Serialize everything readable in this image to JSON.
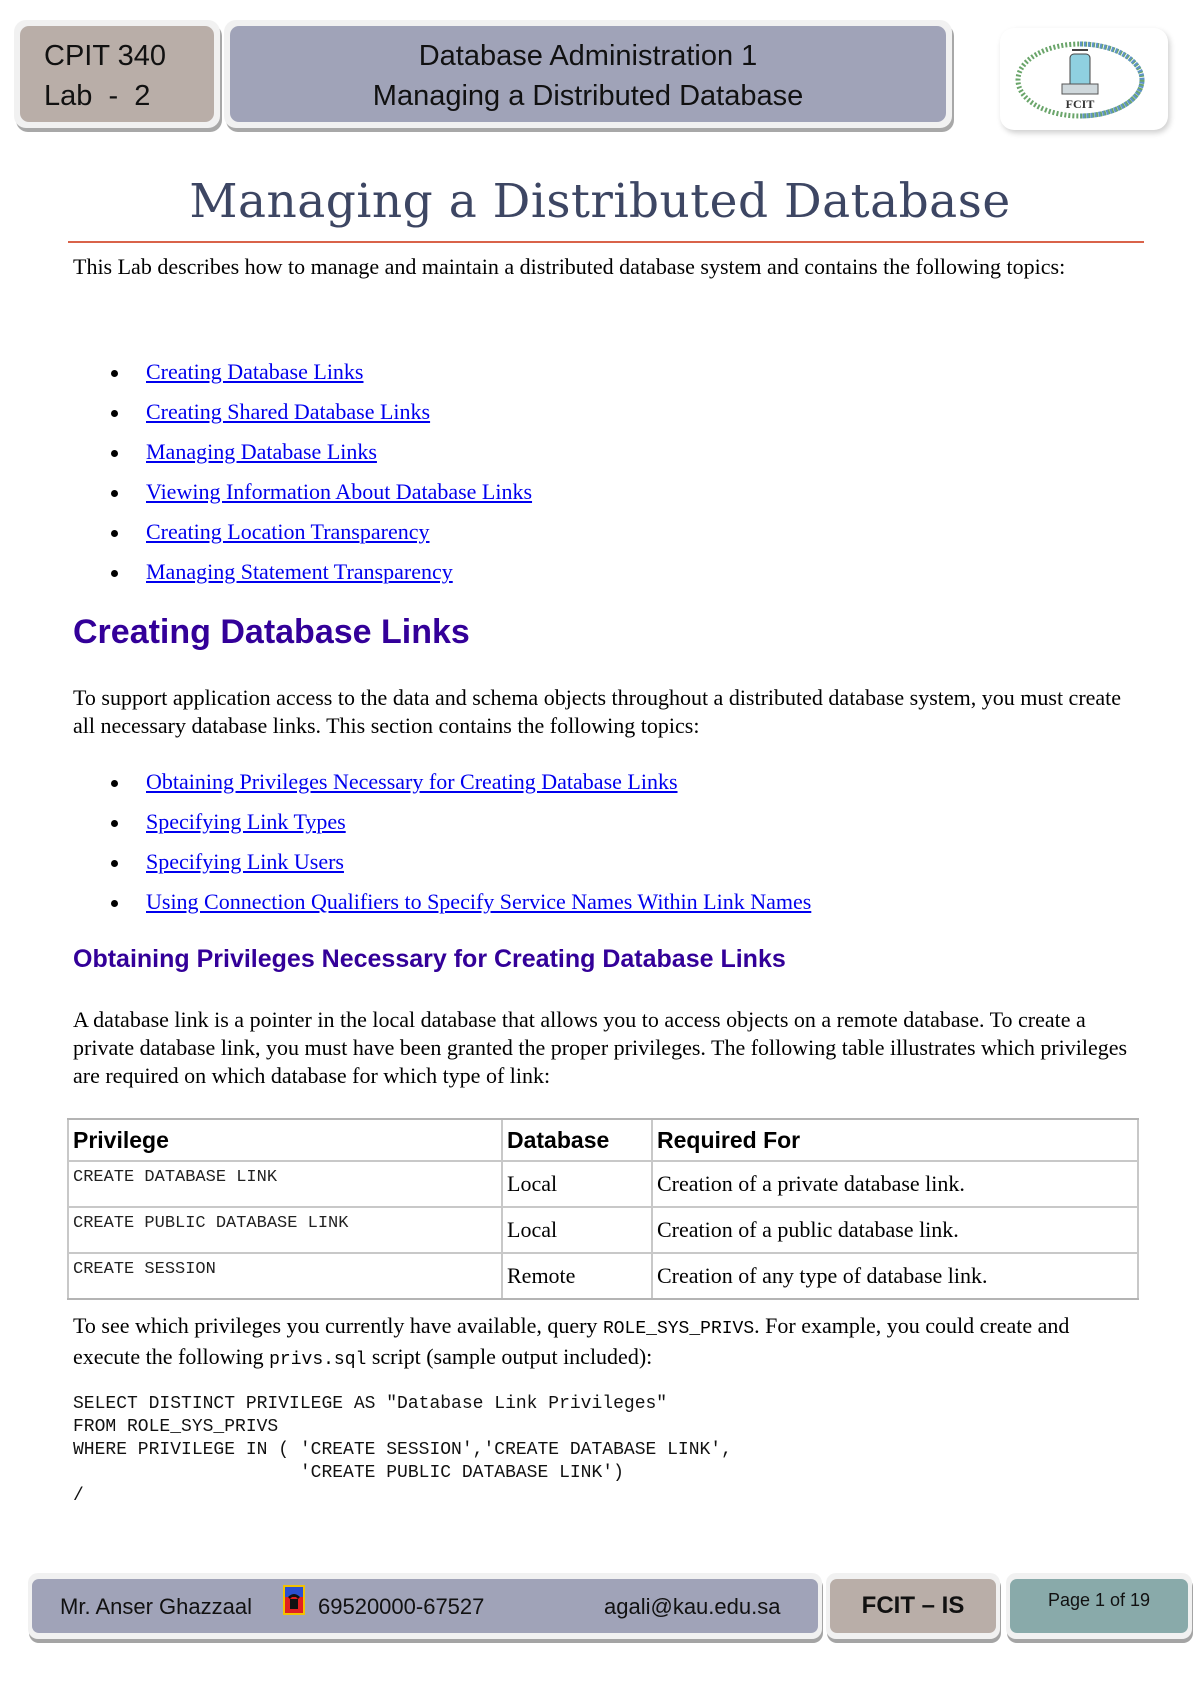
{
  "header": {
    "course_code": "CPIT 340",
    "lab_label": "Lab  -  2",
    "course_title": "Database Administration 1",
    "lab_title": "Managing a Distributed Database",
    "logo_text": "FCIT"
  },
  "document": {
    "title": "Managing a Distributed Database",
    "accent_color": "#d9634a",
    "heading_color": "#330099",
    "link_color": "#0000ee",
    "intro": "This Lab describes how to manage and maintain a distributed database system and contains the following topics:",
    "topics": [
      "Creating Database Links",
      "Creating Shared Database Links",
      "Managing Database Links",
      "Viewing Information About Database Links",
      "Creating Location Transparency",
      "Managing Statement Transparency"
    ],
    "section1": {
      "heading": "Creating Database Links",
      "text": "To support application access to the data and schema objects throughout a distributed database system, you must create all necessary database links. This section contains the following topics:",
      "topics": [
        "Obtaining Privileges Necessary for Creating Database Links",
        "Specifying Link Types",
        "Specifying Link Users",
        "Using Connection Qualifiers to Specify Service Names Within Link Names"
      ]
    },
    "section2": {
      "heading": "Obtaining Privileges Necessary for Creating Database Links",
      "text": "A database link is a pointer in the local database that allows you to access objects on a remote database. To create a private database link, you must have been granted the proper privileges. The following table illustrates which privileges are required on which database for which type of link:",
      "table": {
        "headers": [
          "Privilege",
          "Database",
          "Required For"
        ],
        "rows": [
          [
            "CREATE DATABASE LINK",
            "Local",
            "Creation of a private database link."
          ],
          [
            "CREATE PUBLIC DATABASE LINK",
            "Local",
            "Creation of a public database link."
          ],
          [
            "CREATE SESSION",
            "Remote",
            "Creation of any type of database link."
          ]
        ]
      },
      "query_text_1": "To see which privileges you currently have available, query ",
      "query_code_1": "ROLE_SYS_PRIVS",
      "query_text_2": ". For example, you could create and execute the following ",
      "query_code_2": "privs.sql",
      "query_text_3": " script (sample output included):",
      "code": "SELECT DISTINCT PRIVILEGE AS \"Database Link Privileges\"\nFROM ROLE_SYS_PRIVS\nWHERE PRIVILEGE IN ( 'CREATE SESSION','CREATE DATABASE LINK',\n                     'CREATE PUBLIC DATABASE LINK')\n/"
    }
  },
  "footer": {
    "instructor": "Mr. Anser Ghazzaal",
    "phone_icon": "telephone-icon",
    "phone": "69520000-67527",
    "email": "agali@kau.edu.sa",
    "department": "FCIT – IS",
    "page_label": "Page 1 of 19"
  }
}
